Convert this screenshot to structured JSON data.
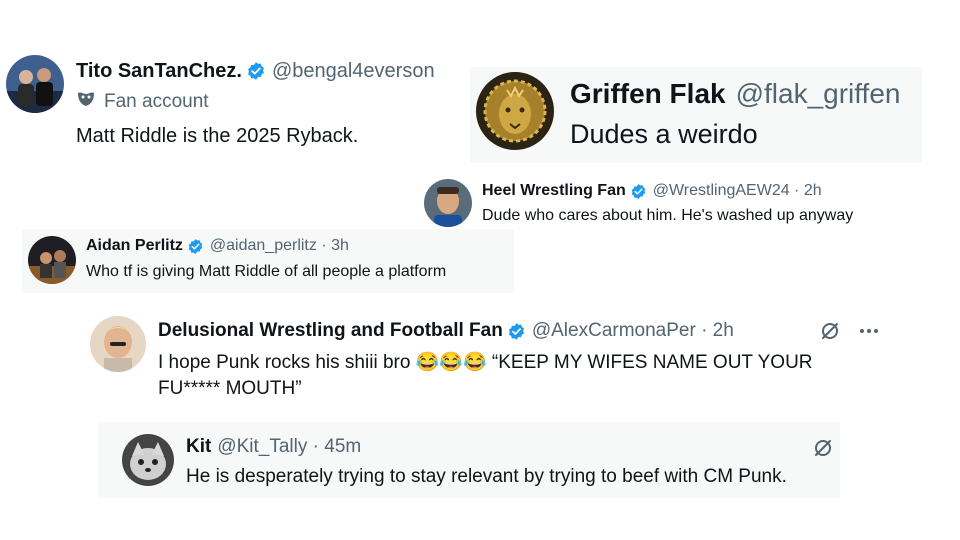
{
  "colors": {
    "verified": "#1d9bf0",
    "text": "#0f1419",
    "muted": "#536471",
    "card_bg": "#f7f9f9"
  },
  "tweets": [
    {
      "name": "Tito SanTanChez.",
      "handle": "@bengal4everson",
      "verified": true,
      "label_icon": "mask-icon",
      "label": "Fan account",
      "text": "Matt Riddle is the 2025 Ryback."
    },
    {
      "name": "Griffen Flak",
      "handle": "@flak_griffen",
      "verified": false,
      "avatar_icon": "lion-icon",
      "text": "Dudes a weirdo"
    },
    {
      "name": "Heel Wrestling Fan",
      "handle": "@WrestlingAEW24 · 2h",
      "verified": true,
      "text": "Dude who cares about him. He's washed up anyway"
    },
    {
      "name": "Aidan Perlitz",
      "handle": "@aidan_perlitz · 3h",
      "verified": true,
      "text": "Who tf is giving Matt Riddle of all people a platform"
    },
    {
      "name": "Delusional Wrestling and Football Fan",
      "handle": "@AlexCarmonaPer · 2h",
      "verified": true,
      "text_line1": "I hope Punk rocks his shiii bro 😂😂😂 “KEEP MY WIFES NAME OUT YOUR",
      "text_line2": "FU***** MOUTH”",
      "actions": [
        "grok-icon",
        "more-icon"
      ]
    },
    {
      "name": "Kit",
      "handle": "@Kit_Tally · 45m",
      "verified": false,
      "text": "He is desperately trying to stay relevant by trying to beef with CM Punk.",
      "actions": [
        "grok-icon"
      ]
    }
  ]
}
